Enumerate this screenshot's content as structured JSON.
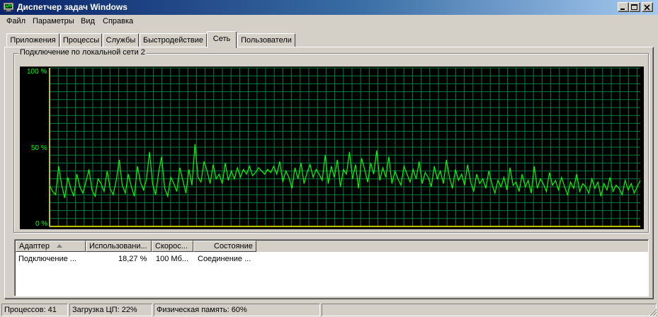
{
  "window": {
    "title": "Диспетчер задач Windows",
    "icon": "task-manager-icon"
  },
  "menu": [
    "Файл",
    "Параметры",
    "Вид",
    "Справка"
  ],
  "tabs": [
    {
      "label": "Приложения",
      "active": false
    },
    {
      "label": "Процессы",
      "active": false
    },
    {
      "label": "Службы",
      "active": false
    },
    {
      "label": "Быстродействие",
      "active": false
    },
    {
      "label": "Сеть",
      "active": true
    },
    {
      "label": "Пользователи",
      "active": false
    }
  ],
  "network": {
    "group_title": "Подключение по локальной сети 2",
    "graph": {
      "y_labels": [
        "100 %",
        "50 %",
        "0 %"
      ],
      "colors": {
        "background": "#000000",
        "grid": "#008040",
        "line": "#00ff00",
        "baseline": "#ffff00"
      },
      "usage_percent": [
        26,
        22,
        20,
        38,
        26,
        18,
        31,
        24,
        19,
        33,
        25,
        21,
        28,
        36,
        23,
        19,
        30,
        27,
        22,
        35,
        24,
        20,
        29,
        42,
        26,
        21,
        33,
        25,
        19,
        38,
        28,
        23,
        30,
        47,
        27,
        20,
        34,
        44,
        24,
        19,
        31,
        27,
        22,
        37,
        29,
        21,
        36,
        26,
        52,
        31,
        28,
        41,
        35,
        27,
        39,
        30,
        33,
        27,
        40,
        29,
        35,
        30,
        37,
        31,
        36,
        33,
        38,
        32,
        34,
        37,
        35,
        33,
        36,
        34,
        38,
        33,
        41,
        28,
        35,
        31,
        24,
        37,
        30,
        40,
        27,
        34,
        39,
        31,
        36,
        33,
        29,
        45,
        27,
        38,
        31,
        42,
        25,
        36,
        33,
        47,
        30,
        39,
        24,
        43,
        36,
        28,
        40,
        33,
        48,
        29,
        37,
        31,
        44,
        27,
        35,
        30,
        26,
        38,
        33,
        28,
        36,
        30,
        41,
        27,
        34,
        31,
        25,
        38,
        30,
        35,
        27,
        42,
        31,
        24,
        36,
        29,
        33,
        26,
        39,
        28,
        22,
        33,
        27,
        30,
        24,
        35,
        27,
        21,
        29,
        25,
        31,
        23,
        37,
        26,
        28,
        22,
        33,
        25,
        29,
        21,
        38,
        24,
        30,
        27,
        22,
        34,
        26,
        29,
        23,
        31,
        25,
        20,
        28,
        24,
        33,
        22,
        27,
        25,
        21,
        30,
        24,
        28,
        19,
        27,
        23,
        31,
        22,
        26,
        24,
        20,
        29,
        23,
        27,
        21,
        25,
        29
      ]
    }
  },
  "adapters": {
    "columns": [
      {
        "label": "Адаптер",
        "sorted": true
      },
      {
        "label": "Использовани...",
        "sorted": false
      },
      {
        "label": "Скорос...",
        "sorted": false
      },
      {
        "label": "Состояние",
        "sorted": false
      }
    ],
    "rows": [
      {
        "adapter": "Подключение ...",
        "usage": "18,27 %",
        "speed": "100 Мб...",
        "state": "Соединение ..."
      }
    ]
  },
  "statusbar": {
    "processes": "Процессов: 41",
    "cpu": "Загрузка ЦП: 22%",
    "memory": "Физическая память: 60%"
  }
}
